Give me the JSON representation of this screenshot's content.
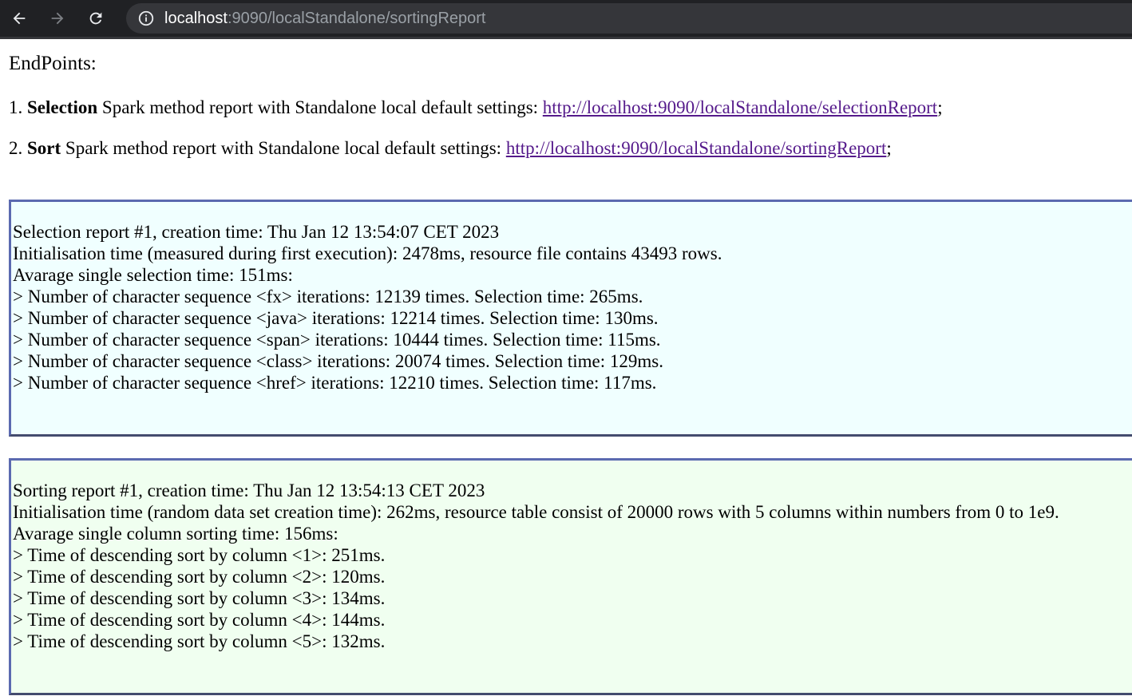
{
  "browser": {
    "url_host": "localhost",
    "url_rest": ":9090/localStandalone/sortingReport"
  },
  "endpoints": {
    "title": "EndPoints:",
    "items": [
      {
        "number": "1.",
        "bold": "Selection",
        "text": " Spark method report with Standalone local default settings: ",
        "link": "http://localhost:9090/localStandalone/selectionReport",
        "suffix": ";"
      },
      {
        "number": "2.",
        "bold": "Sort",
        "text": " Spark method report with Standalone local default settings: ",
        "link": "http://localhost:9090/localStandalone/sortingReport",
        "suffix": ";"
      }
    ]
  },
  "selection_report": {
    "header": "Selection report #1, creation time: Thu Jan 12 13:54:07 CET 2023",
    "lines": [
      "Initialisation time (measured during first execution): 2478ms, resource file contains 43493 rows.",
      "Avarage single selection time: 151ms:",
      "> Number of character sequence <fx> iterations: 12139 times. Selection time: 265ms.",
      "> Number of character sequence <java> iterations: 12214 times. Selection time: 130ms.",
      "> Number of character sequence <span> iterations: 10444 times. Selection time: 115ms.",
      "> Number of character sequence <class> iterations: 20074 times. Selection time: 129ms.",
      "> Number of character sequence <href> iterations: 12210 times. Selection time: 117ms."
    ]
  },
  "sorting_report": {
    "header": "Sorting report #1, creation time: Thu Jan 12 13:54:13 CET 2023",
    "lines": [
      "Initialisation time (random data set creation time): 262ms, resource table consist of 20000 rows with 5 columns within numbers from 0 to 1e9.",
      "Avarage single column sorting time: 156ms:",
      "> Time of descending sort by column <1>: 251ms.",
      "> Time of descending sort by column <2>: 120ms.",
      "> Time of descending sort by column <3>: 134ms.",
      "> Time of descending sort by column <4>: 144ms.",
      "> Time of descending sort by column <5>: 132ms."
    ]
  }
}
